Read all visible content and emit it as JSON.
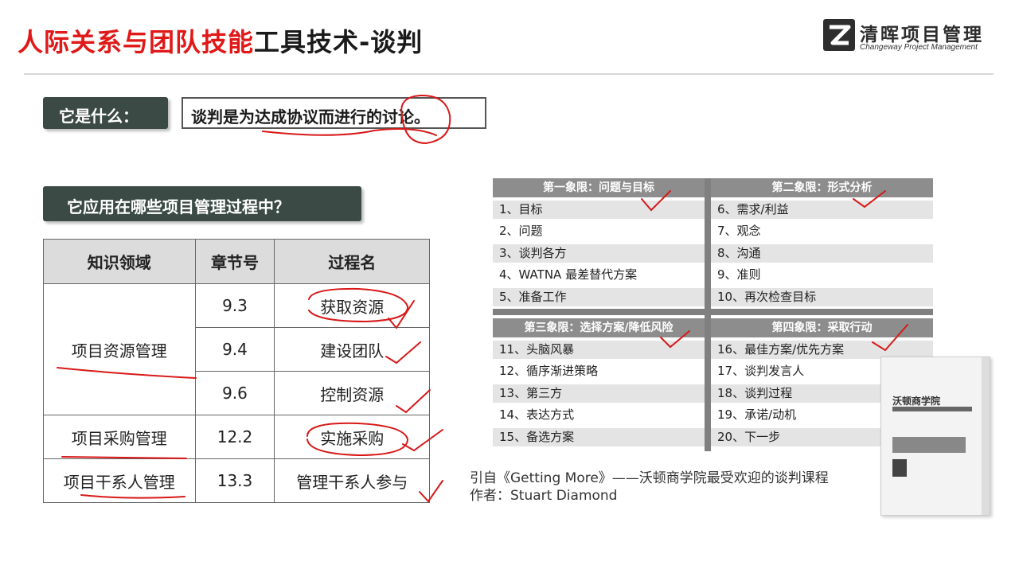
{
  "header": {
    "title_red": "人际关系与团队技能",
    "title_black": "工具技术-谈判",
    "logo_name": "清晖项目管理",
    "logo_en": "Changeway Project Management"
  },
  "what": {
    "label": "它是什么：",
    "definition": "谈判是为达成协议而进行的讨论。"
  },
  "apply": {
    "label": "它应用在哪些项目管理过程中？"
  },
  "table": {
    "headers": [
      "知识领域",
      "章节号",
      "过程名"
    ],
    "rows": [
      {
        "area": "项目资源管理",
        "chapter": "9.3",
        "process": "获取资源"
      },
      {
        "area": "",
        "chapter": "9.4",
        "process": "建设团队"
      },
      {
        "area": "",
        "chapter": "9.6",
        "process": "控制资源"
      },
      {
        "area": "项目采购管理",
        "chapter": "12.2",
        "process": "实施采购"
      },
      {
        "area": "项目干系人管理",
        "chapter": "13.3",
        "process": "管理干系人参与"
      }
    ]
  },
  "quadrants": [
    {
      "title": "第一象限：问题与目标",
      "items": [
        "1、目标",
        "2、问题",
        "3、谈判各方",
        "4、WATNA 最差替代方案",
        "5、准备工作"
      ]
    },
    {
      "title": "第二象限：形式分析",
      "items": [
        "6、需求/利益",
        "7、观念",
        "8、沟通",
        "9、准则",
        "10、再次检查目标"
      ]
    },
    {
      "title": "第三象限：选择方案/降低风险",
      "items": [
        "11、头脑风暴",
        "12、循序渐进策略",
        "13、第三方",
        "14、表达方式",
        "15、备选方案"
      ]
    },
    {
      "title": "第四象限：采取行动",
      "items": [
        "16、最佳方案/优先方案",
        "17、谈判发言人",
        "18、谈判过程",
        "19、承诺/动机",
        "20、下一步"
      ]
    }
  ],
  "quote": {
    "line1": "引自《Getting More》——沃顿商学院最受欢迎的谈判课程",
    "line2": "作者：Stuart Diamond"
  },
  "book": {
    "title": "沃顿商学院"
  },
  "colors": {
    "title_red": "#e01818",
    "label_bg": "#3b4a45",
    "quad_header": "#8d8d8d",
    "ink": "#d81818"
  }
}
